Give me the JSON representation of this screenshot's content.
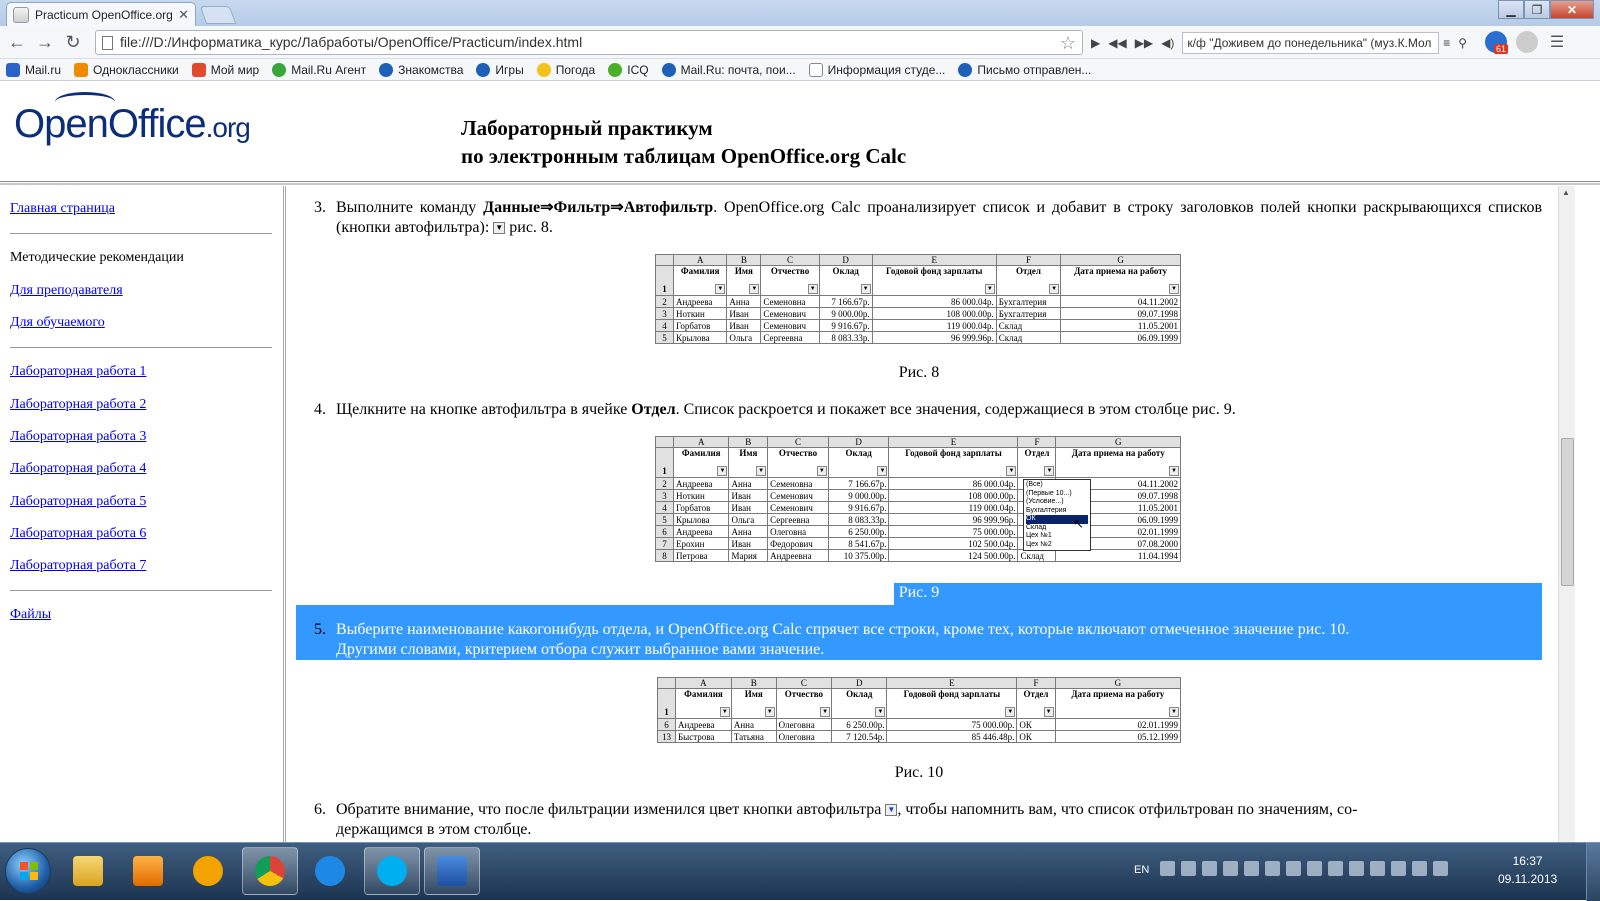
{
  "browser": {
    "tab_title": "Practicum OpenOffice.org",
    "url": "file:///D:/Информатика_курс/Лабработы/OpenOffice/Practicum/index.html",
    "player_track": "к/ф \"Доживем до понедельника\" (муз.К.Мол",
    "bookmarks": [
      "Mail.ru",
      "Одноклассники",
      "Мой мир",
      "Mail.Ru Агент",
      "Знакомства",
      "Игры",
      "Погода",
      "ICQ",
      "Mail.Ru: почта, пои...",
      "Информация студе...",
      "Письмо отправлен..."
    ],
    "mail_badge": "61"
  },
  "header": {
    "logo_main": "OpenOffice",
    "logo_org": ".org",
    "title_line1": "Лабораторный практикум",
    "title_line2": "по электронным таблицам OpenOffice.org Calc"
  },
  "sidebar": {
    "home": "Главная страница",
    "methodics": "Методические рекомендации",
    "for_teacher": "Для преподавателя",
    "for_student": "Для обучаемого",
    "labs": [
      "Лабораторная работа 1",
      "Лабораторная работа 2",
      "Лабораторная работа 3",
      "Лабораторная работа 4",
      "Лабораторная работа 5",
      "Лабораторная работа 6",
      "Лабораторная работа 7"
    ],
    "files": "Файлы"
  },
  "content": {
    "step3": {
      "num": "3.",
      "pre": "Выполните команду ",
      "bold": "Данные⇒Фильтр⇒Автофильтр",
      "post1": ". OpenOffice.org Calc проанализирует список и добавит в строку заголовков полей кнопки раскрывающихся списков (кнопки автофильтра): ",
      "post2": " рис. 8."
    },
    "fig8_caption": "Рис. 8",
    "step4": {
      "num": "4.",
      "pre": "Щелкните на кнопке автофильтра в ячейке ",
      "bold": "Отдел",
      "post": ". Список раскроется и покажет все значения, содержащиеся в этом столбце рис. 9."
    },
    "fig9_caption": "Рис. 9",
    "step5": {
      "num": "5.",
      "line1": "Выберите наименование какогонибудь отдела, и OpenOffice.org Calc спрячет все строки, кроме тех, которые включают отмеченное значение рис. 10.",
      "line2": "Другими словами, критерием отбора служит выбранное вами значение."
    },
    "fig10_caption": "Рис. 10",
    "step6": {
      "num": "6.",
      "pre": "Обратите внимание, что после фильтрации изменился цвет кнопки автофильтра ",
      "post1": ", чтобы напомнить вам, что список отфильтрован по значениям, со-",
      "post2": "держащимся в этом столбце."
    }
  },
  "sheet": {
    "cols": [
      "A",
      "B",
      "C",
      "D",
      "E",
      "F",
      "G"
    ],
    "headers": [
      "Фамилия",
      "Имя",
      "Отчество",
      "Оклад",
      "Годовой фонд зарплаты",
      "Отдел",
      "Дата приема на работу"
    ],
    "fig8_rows": [
      [
        "2",
        "Андреева",
        "Анна",
        "Семеновна",
        "7 166.67р.",
        "86 000.04р.",
        "Бухгалтерия",
        "04.11.2002"
      ],
      [
        "3",
        "Ноткин",
        "Иван",
        "Семенович",
        "9 000.00р.",
        "108 000.00р.",
        "Бухгалтерия",
        "09.07.1998"
      ],
      [
        "4",
        "Горбатов",
        "Иван",
        "Семенович",
        "9 916.67р.",
        "119 000.04р.",
        "Склад",
        "11.05.2001"
      ],
      [
        "5",
        "Крылова",
        "Ольга",
        "Сергеевна",
        "8 083.33р.",
        "96 999.96р.",
        "Склад",
        "06.09.1999"
      ]
    ],
    "fig9_rows": [
      [
        "2",
        "Андреева",
        "Анна",
        "Семеновна",
        "7 166.67р.",
        "86 000.04р.",
        "",
        "04.11.2002"
      ],
      [
        "3",
        "Ноткин",
        "Иван",
        "Семенович",
        "9 000.00р.",
        "108 000.00р.",
        "",
        "09.07.1998"
      ],
      [
        "4",
        "Горбатов",
        "Иван",
        "Семенович",
        "9 916.67р.",
        "119 000.04р.",
        "",
        "11.05.2001"
      ],
      [
        "5",
        "Крылова",
        "Ольга",
        "Сергеевна",
        "8 083.33р.",
        "96 999.96р.",
        "",
        "06.09.1999"
      ],
      [
        "6",
        "Андреева",
        "Анна",
        "Олеговна",
        "6 250.00р.",
        "75 000.00р.",
        "",
        "02.01.1999"
      ],
      [
        "7",
        "Ерохин",
        "Иван",
        "Федорович",
        "8 541.67р.",
        "102 500.04р.",
        "",
        "07.08.2000"
      ],
      [
        "8",
        "Петрова",
        "Мария",
        "Андреевна",
        "10 375.00р.",
        "124 500.00р.",
        "Склад",
        "11.04.1994"
      ]
    ],
    "fig9_dropdown": [
      "(Все)",
      "(Первые 10...)",
      "(Условие...)",
      "Бухгалтерия",
      "ОК",
      "Склад",
      "Цех №1",
      "Цех №2"
    ],
    "fig9_dropdown_selected": "ОК",
    "fig10_rows": [
      [
        "6",
        "Андреева",
        "Анна",
        "Олеговна",
        "6 250.00р.",
        "75 000.00р.",
        "ОК",
        "02.01.1999"
      ],
      [
        "13",
        "Быстрова",
        "Татьяна",
        "Олеговна",
        "7 120.54р.",
        "85 446.48р.",
        "ОК",
        "05.12.1999"
      ]
    ]
  },
  "taskbar": {
    "lang": "EN",
    "time": "16:37",
    "date": "09.11.2013"
  }
}
